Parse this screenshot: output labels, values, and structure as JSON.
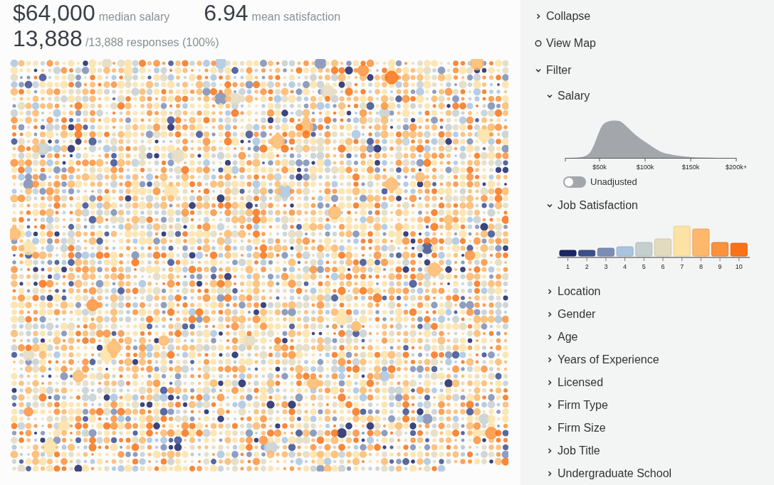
{
  "stats": [
    {
      "value": "$64,000",
      "label": "median salary"
    },
    {
      "value": "6.94",
      "label": "mean satisfaction"
    }
  ],
  "responses": {
    "value": "13,888",
    "label": "/13,888 responses (100%)"
  },
  "sidebar": {
    "items": [
      {
        "label": "Collapse",
        "kind": "action",
        "expanded": false
      },
      {
        "label": "View Map",
        "kind": "radio",
        "selected": false
      },
      {
        "label": "Filter",
        "kind": "group",
        "expanded": true,
        "children": [
          {
            "label": "Salary",
            "kind": "density",
            "expanded": true,
            "axis_labels": [
              "$50k",
              "$100k",
              "$150k",
              "$200k+"
            ],
            "toggle": {
              "label": "Unadjusted",
              "on": false
            }
          },
          {
            "label": "Job Satisfaction",
            "kind": "bars",
            "expanded": true,
            "axis_labels": [
              "1",
              "2",
              "3",
              "4",
              "5",
              "6",
              "7",
              "8",
              "9",
              "10"
            ]
          },
          {
            "label": "Location",
            "kind": "section",
            "expanded": false
          },
          {
            "label": "Gender",
            "kind": "section",
            "expanded": false
          },
          {
            "label": "Age",
            "kind": "section",
            "expanded": false
          },
          {
            "label": "Years of Experience",
            "kind": "section",
            "expanded": false
          },
          {
            "label": "Licensed",
            "kind": "section",
            "expanded": false
          },
          {
            "label": "Firm Type",
            "kind": "section",
            "expanded": false
          },
          {
            "label": "Firm Size",
            "kind": "section",
            "expanded": false
          },
          {
            "label": "Job Title",
            "kind": "section",
            "expanded": false
          },
          {
            "label": "Undergraduate School",
            "kind": "section",
            "expanded": false
          }
        ]
      }
    ]
  }
}
